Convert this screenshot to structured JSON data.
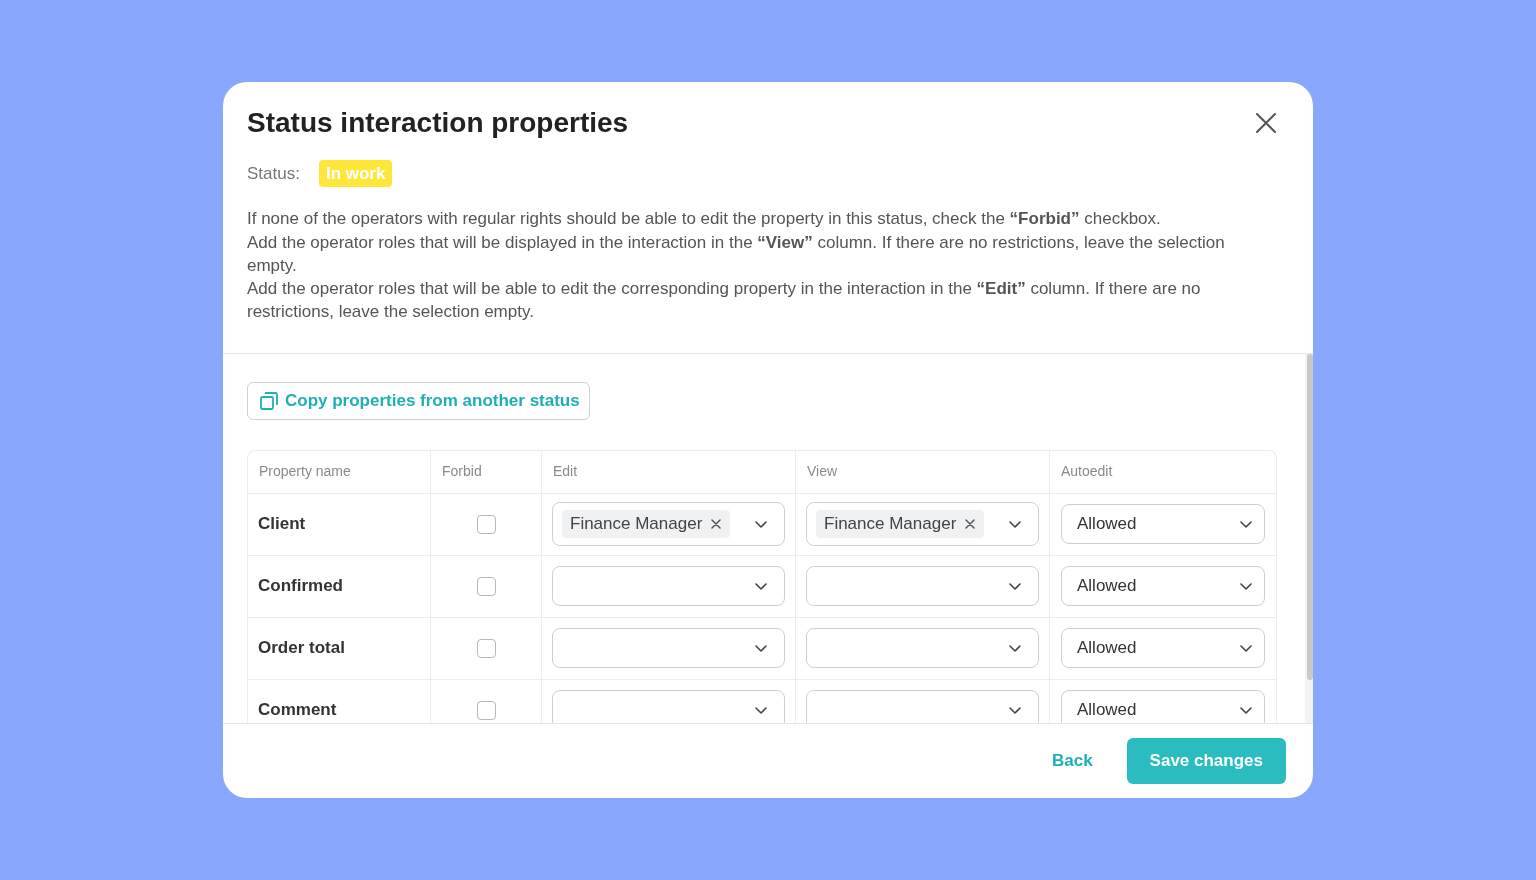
{
  "dialog": {
    "title": "Status interaction properties",
    "status": {
      "label": "Status:",
      "value": "In work"
    },
    "description": [
      "If none of the operators with regular rights should be able to edit the property in this status, check the **“Forbid”** checkbox.",
      "Add the operator roles that will be displayed in the interaction in the **“View”** column. If there are no restrictions, leave the selection empty.",
      "Add the operator roles that will be able to edit the corresponding property in the interaction in the **“Edit”** column. If there are no restrictions, leave the selection empty."
    ],
    "copy_button": "Copy properties from another status",
    "table": {
      "columns": [
        "Property name",
        "Forbid",
        "Edit",
        "View",
        "Autoedit"
      ],
      "rows": [
        {
          "property_name": "Client",
          "forbid": false,
          "edit": [
            "Finance Manager"
          ],
          "view": [
            "Finance Manager"
          ],
          "autoedit": "Allowed"
        },
        {
          "property_name": "Confirmed",
          "forbid": false,
          "autoedit": "Allowed"
        },
        {
          "property_name": "Order total",
          "forbid": false,
          "autoedit": "Allowed"
        },
        {
          "property_name": "Comment",
          "forbid": false,
          "autoedit": "Allowed"
        }
      ]
    },
    "buttons": {
      "back": "Back",
      "save": "Save changes"
    }
  }
}
